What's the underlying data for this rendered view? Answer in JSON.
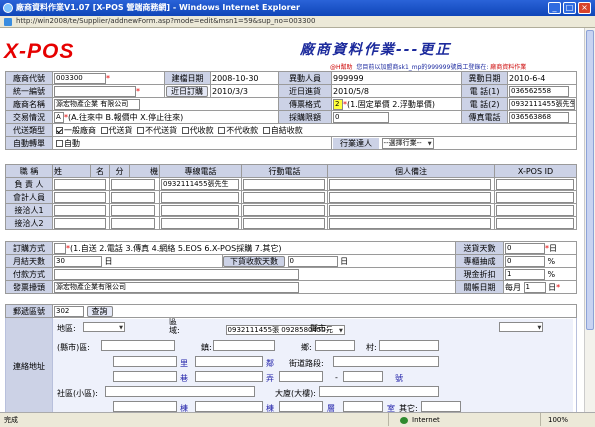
{
  "window": {
    "title": "廠商資料作業V1.07 [X-POS 營端商務網] - Windows Internet Explorer",
    "address": "http://win2008/te/Supplier/addnewForm.asp?mode=edit&msn1=59&sup_no=003300",
    "buttons": {
      "minimize": "_",
      "maximize": "□",
      "close": "×"
    }
  },
  "header": {
    "logo": "X-POS",
    "title": "廠商資料作業---更正",
    "help_link": "@H幫助",
    "notice": "您目前以加盟商sk1_mp的999999號員工登錄在:",
    "store": "廠商資料作業"
  },
  "form": {
    "vendor_code_label": "廠商代號",
    "vendor_code": "003300",
    "created_date_label": "建檔日期",
    "created_date": "2008-10-30",
    "changed_by_label": "異動人員",
    "changed_by": "999999",
    "changed_date_label": "異動日期",
    "changed_date": "2010-6-4",
    "tax_id_label": "統一編號",
    "tax_id": "",
    "recent_order_label": "近日訂購",
    "recent_order": "2010/3/3",
    "recent_purchase_label": "近日進貨",
    "recent_purchase": "2010/5/8",
    "phone1_label": "電 話(1)",
    "phone1": "036562558",
    "vendor_name_label": "廠商名稱",
    "vendor_name": "源宏物產企業 有限公司",
    "doc_format_label": "傳票格式",
    "doc_format_value": "2",
    "doc_format_hint": "(1.固定單價 2.浮動單價)",
    "phone2_label": "電 話(2)",
    "phone2": "0932111455張先生",
    "trade_status_label": "交易情況",
    "trade_status_value": "A",
    "trade_status_hint": "(A.往來中 B.報價中 X.停止往來)",
    "purchase_limit_label": "採購限額",
    "purchase_limit": "0",
    "fax_label": "傳真電話",
    "fax": "036563868",
    "agent_type_label": "代送類型",
    "agent_options": [
      {
        "label": "一般廠商",
        "checked": true
      },
      {
        "label": "代送貨",
        "checked": false
      },
      {
        "label": "不代送貨",
        "checked": false
      },
      {
        "label": "代收款",
        "checked": false
      },
      {
        "label": "不代收款",
        "checked": false
      },
      {
        "label": "自結收款",
        "checked": false
      }
    ],
    "auto_transfer_label": "自動轉單",
    "auto_transfer_option": "自動",
    "auto_transfer_checked": false,
    "industry_label": "行業達人",
    "industry_select": "--選擇行業--"
  },
  "contacts": {
    "headers": {
      "role": "職 稱",
      "name": "姓",
      "name2": "名",
      "ext": "分",
      "ext2": "機",
      "phone": "專線電話",
      "mobile": "行動電話",
      "note": "個人備注",
      "xpos_id": "X-POS ID"
    },
    "rows": [
      {
        "role": "負 責 人",
        "name": "",
        "phone": "0932111455張先生",
        "mobile": "",
        "note": "",
        "xpos_id": ""
      },
      {
        "role": "會計人員",
        "name": "",
        "phone": "",
        "mobile": "",
        "note": "",
        "xpos_id": ""
      },
      {
        "role": "接洽人1",
        "name": "",
        "phone": "",
        "mobile": "",
        "note": "",
        "xpos_id": ""
      },
      {
        "role": "接洽人2",
        "name": "",
        "phone": "",
        "mobile": "",
        "note": "",
        "xpos_id": ""
      }
    ]
  },
  "billing": {
    "order_method_label": "訂購方式",
    "order_method_value": "",
    "order_method_hint": "(1.自送 2.電話 3.傳真 4.網絡 5.EOS 6.X-POS採購 7.其它)",
    "delivery_days_label": "送貨天數",
    "delivery_days": "0",
    "delivery_days_unit": "日",
    "settle_days_label": "月結天數",
    "settle_days": "30",
    "settle_days_unit": "日",
    "order_collect_label": "下貨收款天數",
    "order_collect_days": "0",
    "order_collect_unit": "日",
    "commission_label": "專櫃抽成",
    "commission": "0",
    "commission_unit": "%",
    "payment_label": "付款方式",
    "payment": "",
    "cash_discount_label": "現金折扣",
    "cash_discount": "1",
    "cash_discount_unit": "%",
    "invoice_label": "發票擡頭",
    "invoice": "源宏物產企業有限公司",
    "closing_label": "關帳日期",
    "closing_prefix": "每月",
    "closing_day": "1",
    "closing_unit": "日"
  },
  "address": {
    "postal_label": "郵遞區號",
    "postal": "302",
    "lookup_button": "查詢",
    "section_label": "連絡地址",
    "region_label": "地區:",
    "district_label": "區 域:",
    "district_value": "0932111455張 0928580450元",
    "county_label": "縣市:",
    "city_label": "(縣市)區:",
    "town_label": "鎮:",
    "township_label": "鄉:",
    "village_label": "村:",
    "li": "里",
    "lin": "鄰",
    "street_label": "街道路段:",
    "lane": "巷",
    "alley": "弄",
    "dash": "-",
    "number": "號",
    "community_label": "社區(小區):",
    "building_label": "大廈(大樓):",
    "block": "棟",
    "wing": "棟",
    "floor": "層",
    "room": "室",
    "other_label": "其它:"
  },
  "status": {
    "left": "完成",
    "zone": "Internet",
    "zoom": "100%"
  }
}
